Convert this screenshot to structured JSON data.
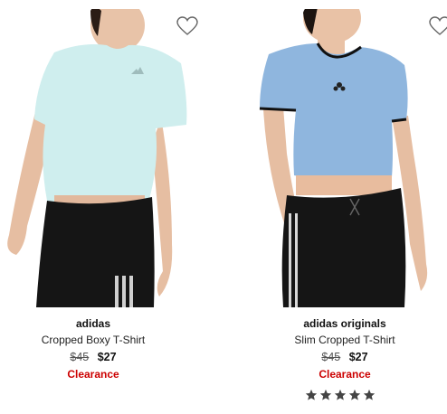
{
  "products": [
    {
      "brand": "adidas",
      "name": "Cropped Boxy T-Shirt",
      "original_price": "$45",
      "sale_price": "$27",
      "badge": "Clearance",
      "shirt_color": "#cfeeee",
      "favorite_icon": "heart-outline-icon"
    },
    {
      "brand": "adidas originals",
      "name": "Slim Cropped T-Shirt",
      "original_price": "$45",
      "sale_price": "$27",
      "badge": "Clearance",
      "shirt_color": "#8fb6de",
      "rating": 5,
      "rating_max": 5,
      "favorite_icon": "heart-outline-icon"
    }
  ],
  "colors": {
    "clearance": "#cc0000",
    "star": "#444444"
  }
}
